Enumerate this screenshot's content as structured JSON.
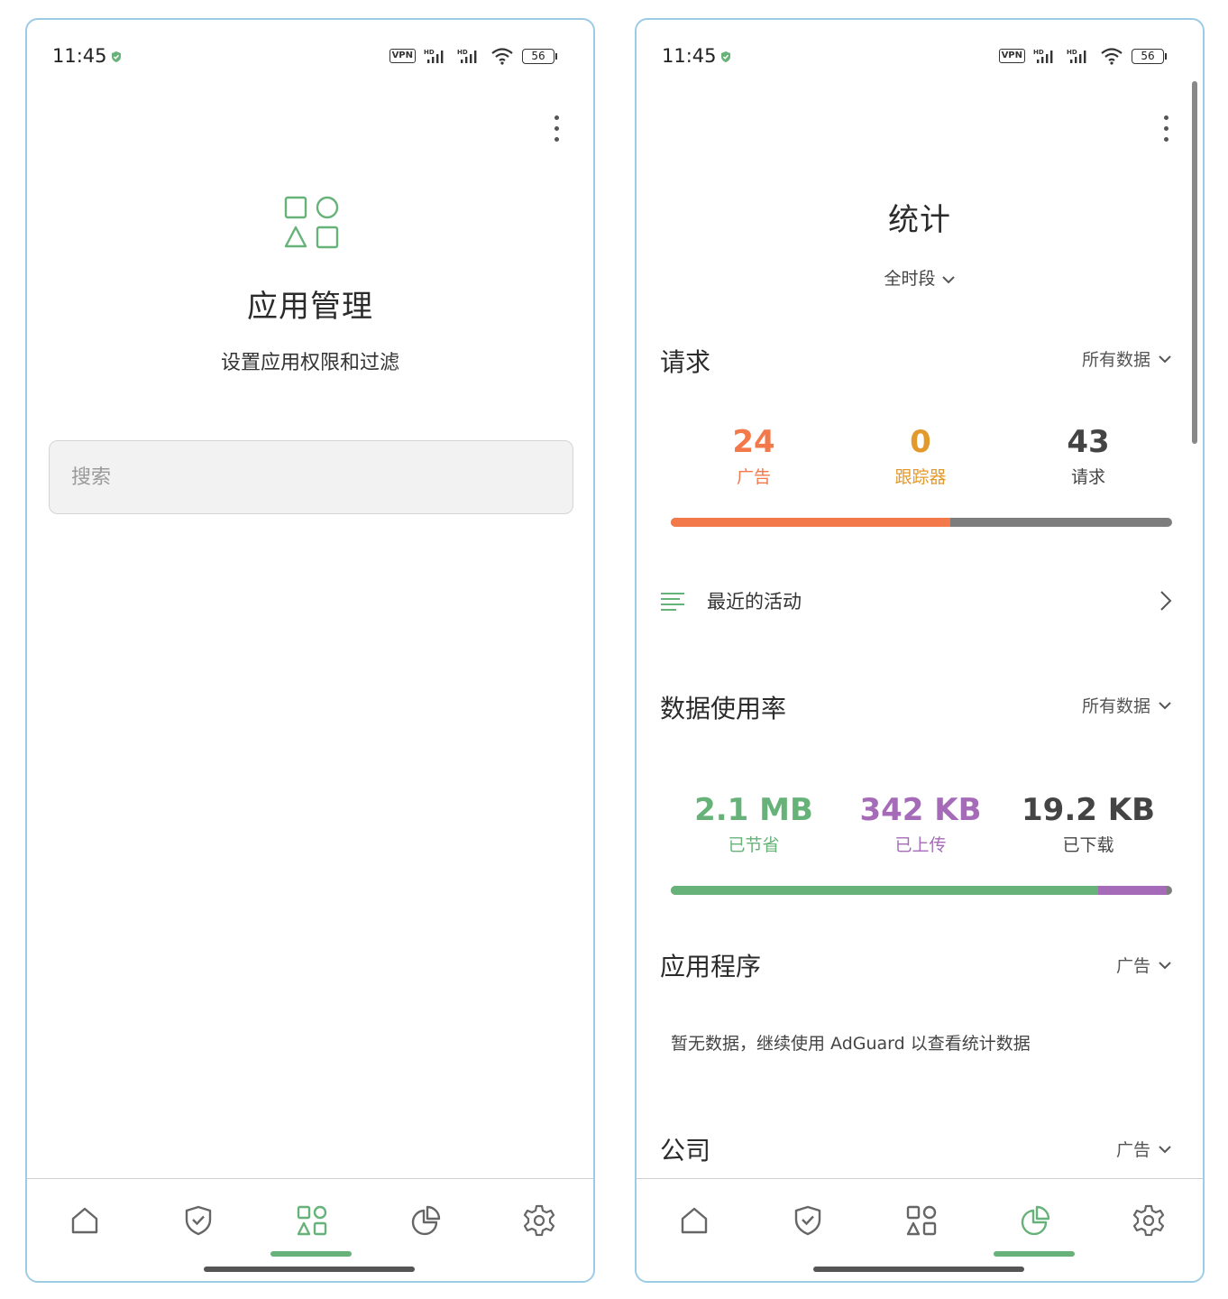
{
  "status_bar": {
    "time": "11:45",
    "vpn_label": "VPN",
    "signal_label": "HD",
    "battery": "56"
  },
  "apps_screen": {
    "title": "应用管理",
    "subtitle": "设置应用权限和过滤",
    "search_placeholder": "搜索"
  },
  "stats_screen": {
    "title": "统计",
    "period": "全时段",
    "requests": {
      "title": "请求",
      "filter": "所有数据",
      "ads_value": "24",
      "ads_label": "广告",
      "trackers_value": "0",
      "trackers_label": "跟踪器",
      "total_value": "43",
      "total_label": "请求",
      "bar": {
        "ads": 24,
        "trackers": 0,
        "total": 43
      }
    },
    "recent_activity": "最近的活动",
    "data_usage": {
      "title": "数据使用率",
      "filter": "所有数据",
      "saved_value": "2.1 MB",
      "saved_label": "已节省",
      "uploaded_value": "342 KB",
      "uploaded_label": "已上传",
      "downloaded_value": "19.2 KB",
      "downloaded_label": "已下载",
      "bar_fractions": {
        "saved": 0.852,
        "uploaded": 0.138,
        "downloaded": 0.01
      }
    },
    "apps_section": {
      "title": "应用程序",
      "filter": "广告",
      "empty_text": "暂无数据，继续使用 AdGuard 以查看统计数据"
    },
    "companies_section": {
      "title": "公司",
      "filter": "广告"
    }
  },
  "nav": {
    "items": [
      "home-icon",
      "shield-check-icon",
      "apps-icon",
      "statistics-icon",
      "settings-icon"
    ],
    "left_active": "apps-icon",
    "right_active": "statistics-icon"
  },
  "colors": {
    "accent_green": "#67b279",
    "ads_orange": "#f4794a",
    "trackers_orange": "#e39a2d",
    "upload_purple": "#a66bb8",
    "neutral_gray": "#7d7d7d"
  }
}
